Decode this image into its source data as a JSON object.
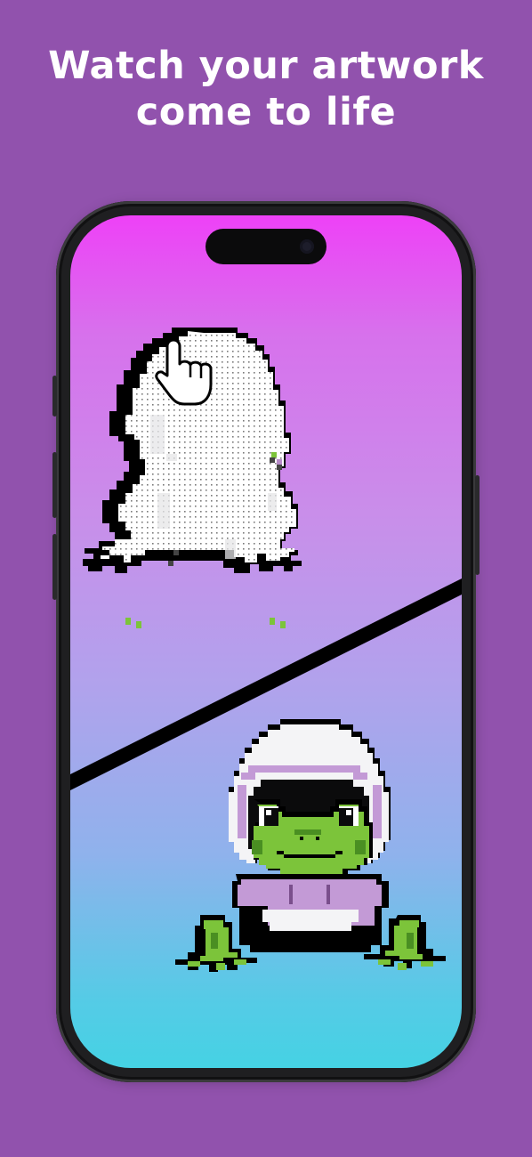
{
  "headline": {
    "line1": "Watch your artwork",
    "line2": "come to life"
  },
  "colors": {
    "background": "#9152ad",
    "headline_text": "#ffffff",
    "screen_gradient_top": "#ee41f7",
    "screen_gradient_bottom": "#45d2e4",
    "frog_green": "#7cc43a",
    "hood_white": "#f4f4f6",
    "hood_lilac": "#c39ad6",
    "divider": "#000000"
  },
  "artwork": {
    "before": {
      "description_icon": "pointer-hand-icon",
      "state": "uncolored-dotted-grid"
    },
    "after": {
      "subject": "frog-in-hoodie",
      "state": "colored"
    }
  }
}
